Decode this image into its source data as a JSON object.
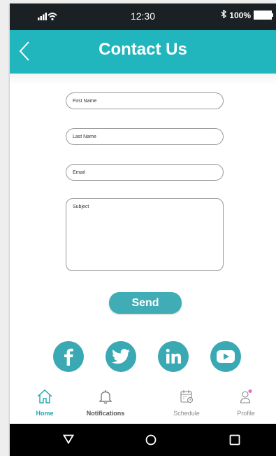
{
  "status_bar": {
    "time": "12:30",
    "battery": "100%"
  },
  "header": {
    "title": "Contact Us"
  },
  "form": {
    "first_name_placeholder": "First Name",
    "last_name_placeholder": "Last Name",
    "email_placeholder": "Email",
    "subject_placeholder": "Subject",
    "send_label": "Send"
  },
  "social": [
    "facebook-icon",
    "twitter-icon",
    "linkedin-icon",
    "youtube-icon"
  ],
  "tabs": {
    "home": "Home",
    "notifications": "Notifications",
    "schedule": "Schedule",
    "profile": "Profile"
  },
  "colors": {
    "header": "#21b6bd",
    "accent": "#40adb6",
    "social": "#3aa9b3",
    "active_tab": "#1fa6b0",
    "profile_dot": "#e86ac6"
  }
}
